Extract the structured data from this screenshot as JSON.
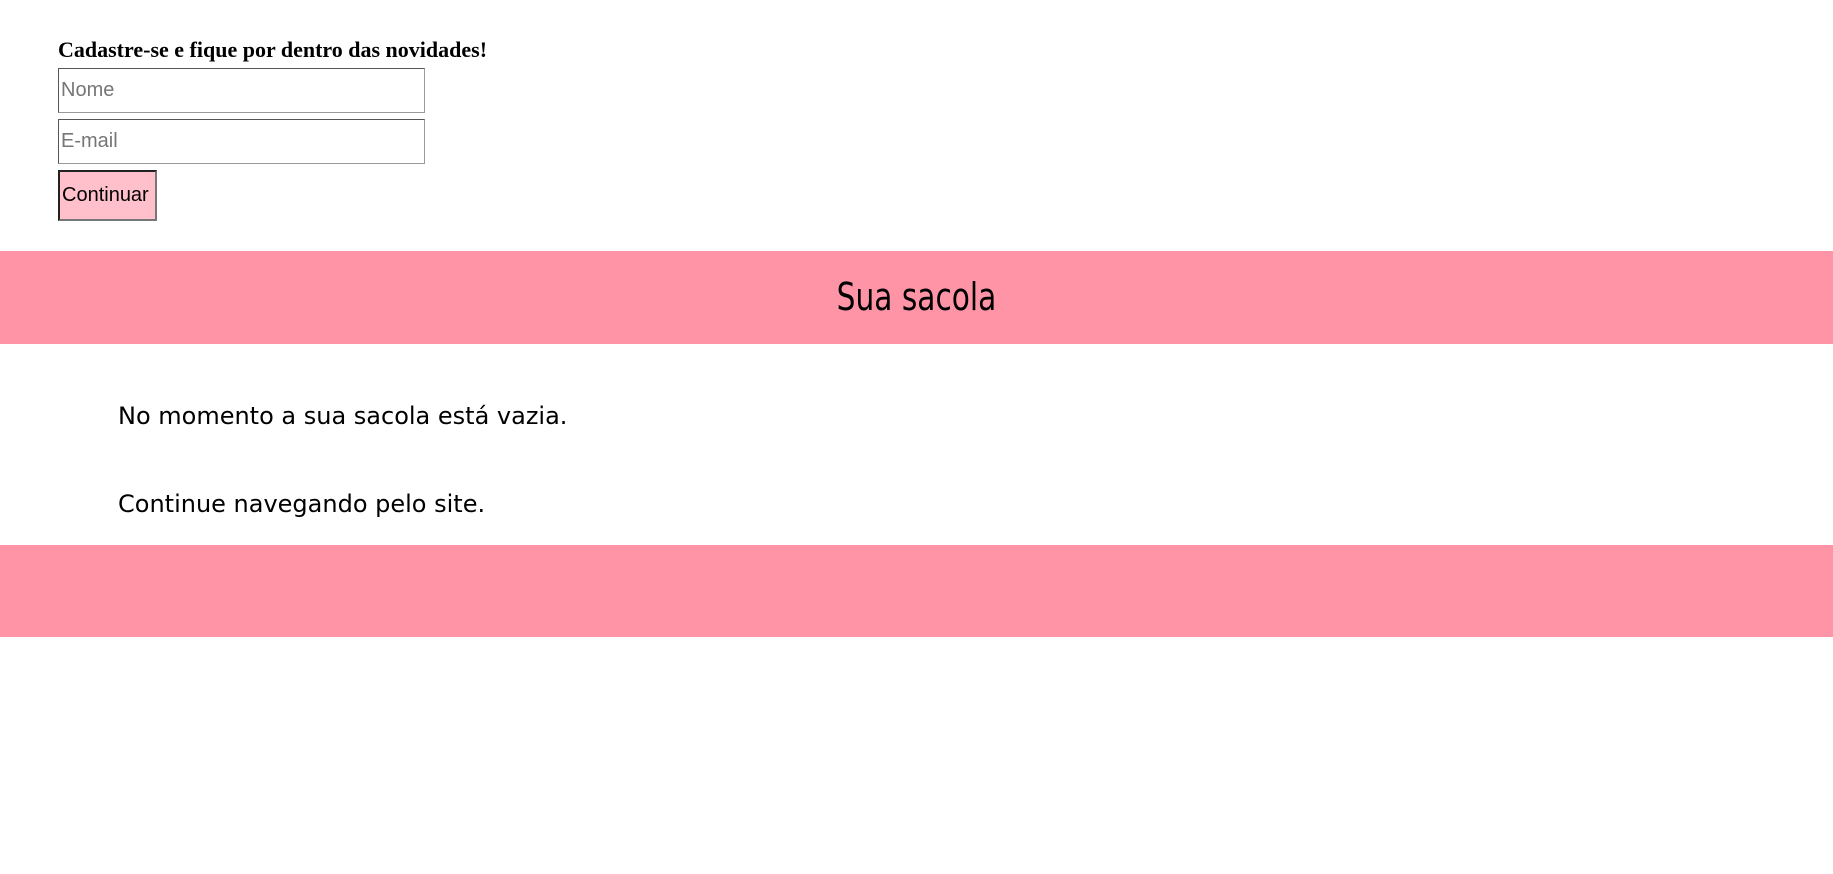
{
  "signup": {
    "title": "Cadastre-se e fique por dentro das novidades!",
    "name_placeholder": "Nome",
    "name_value": "",
    "email_placeholder": "E-mail",
    "email_value": "",
    "submit_label": "Continuar"
  },
  "cart": {
    "heading": "Sua sacola",
    "empty_message": "No momento a sua sacola está vazia.",
    "continue_message": "Continue navegando pelo site."
  },
  "colors": {
    "band": "#ff94a6",
    "button": "#ffc0cb"
  }
}
